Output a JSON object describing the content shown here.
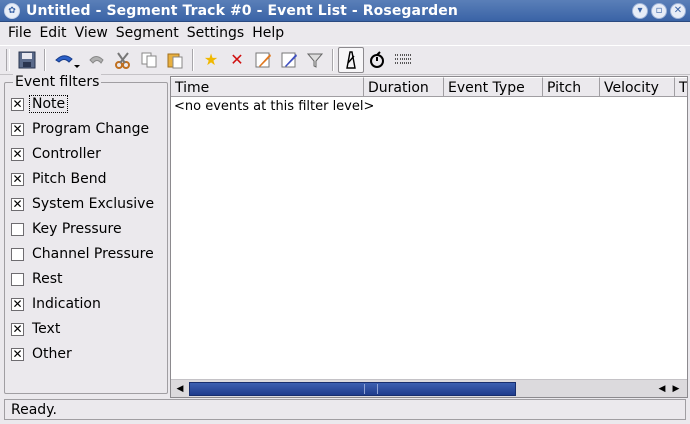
{
  "window": {
    "title": "Untitled - Segment Track #0 - Event List - Rosegarden",
    "app_icon": "rosegarden-icon",
    "controls": [
      "minimize-icon",
      "maximize-icon",
      "close-icon"
    ]
  },
  "menubar": {
    "items": [
      "File",
      "Edit",
      "View",
      "Segment",
      "Settings",
      "Help"
    ]
  },
  "toolbar": {
    "buttons": [
      "save-icon",
      "undo-icon",
      "redo-icon",
      "cut-icon",
      "copy-icon",
      "paste-icon",
      "insert-icon",
      "delete-icon",
      "edit-icon",
      "edit-advanced-icon",
      "filter-icon",
      "tempo-icon",
      "time-signature-icon",
      "list-icon"
    ]
  },
  "filters": {
    "title": "Event filters",
    "items": [
      {
        "label": "Note",
        "checked": true
      },
      {
        "label": "Program Change",
        "checked": true
      },
      {
        "label": "Controller",
        "checked": true
      },
      {
        "label": "Pitch Bend",
        "checked": true
      },
      {
        "label": "System Exclusive",
        "checked": true
      },
      {
        "label": "Key Pressure",
        "checked": false
      },
      {
        "label": "Channel Pressure",
        "checked": false
      },
      {
        "label": "Rest",
        "checked": false
      },
      {
        "label": "Indication",
        "checked": true
      },
      {
        "label": "Text",
        "checked": true
      },
      {
        "label": "Other",
        "checked": true
      }
    ]
  },
  "events": {
    "columns": [
      "Time",
      "Duration",
      "Event Type",
      "Pitch",
      "Velocity",
      "T"
    ],
    "empty_text": "<no events at this filter level>"
  },
  "status": {
    "text": "Ready."
  },
  "colors": {
    "titlebar": "#3a63a6",
    "scroll_thumb": "#2a4a9c"
  }
}
